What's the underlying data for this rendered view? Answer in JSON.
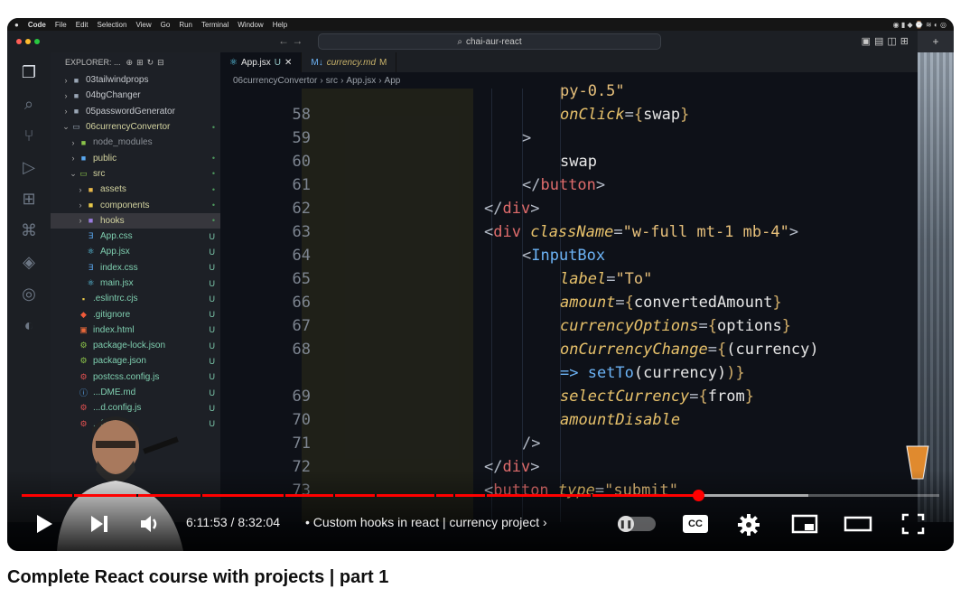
{
  "mac_menu": [
    "Code",
    "File",
    "Edit",
    "Selection",
    "View",
    "Go",
    "Run",
    "Terminal",
    "Window",
    "Help"
  ],
  "editor_window": {
    "search_text": "chai-aur-react",
    "explorer_header": "EXPLORER: ...",
    "tabs": [
      {
        "label": "App.jsx",
        "status": "U",
        "active": true
      },
      {
        "label": "currency.md",
        "status": "M",
        "active": false
      }
    ],
    "breadcrumb": [
      "06currencyConvertor",
      "src",
      "App.jsx",
      "App"
    ],
    "tree": [
      {
        "label": "03tailwindprops",
        "kind": "folder",
        "indent": 1,
        "badge": ""
      },
      {
        "label": "04bgChanger",
        "kind": "folder",
        "indent": 1,
        "badge": ""
      },
      {
        "label": "05passwordGenerator",
        "kind": "folder",
        "indent": 1,
        "badge": ""
      },
      {
        "label": "06currencyConvertor",
        "kind": "folder-open",
        "indent": 1,
        "badge": "•"
      },
      {
        "label": "node_modules",
        "kind": "folder",
        "indent": 2,
        "badge": ""
      },
      {
        "label": "public",
        "kind": "folder",
        "indent": 2,
        "badge": "•"
      },
      {
        "label": "src",
        "kind": "folder-open",
        "indent": 2,
        "badge": "•"
      },
      {
        "label": "assets",
        "kind": "folder",
        "indent": 3,
        "badge": "•"
      },
      {
        "label": "components",
        "kind": "folder",
        "indent": 3,
        "badge": "•"
      },
      {
        "label": "hooks",
        "kind": "folder",
        "indent": 3,
        "badge": "•"
      },
      {
        "label": "App.css",
        "kind": "css",
        "indent": 3,
        "badge": "U"
      },
      {
        "label": "App.jsx",
        "kind": "react",
        "indent": 3,
        "badge": "U"
      },
      {
        "label": "index.css",
        "kind": "css",
        "indent": 3,
        "badge": "U"
      },
      {
        "label": "main.jsx",
        "kind": "react",
        "indent": 3,
        "badge": "U"
      },
      {
        "label": ".eslintrc.cjs",
        "kind": "js",
        "indent": 2,
        "badge": "U"
      },
      {
        "label": ".gitignore",
        "kind": "git",
        "indent": 2,
        "badge": "U"
      },
      {
        "label": "index.html",
        "kind": "html",
        "indent": 2,
        "badge": "U"
      },
      {
        "label": "package-lock.json",
        "kind": "json",
        "indent": 2,
        "badge": "U"
      },
      {
        "label": "package.json",
        "kind": "json",
        "indent": 2,
        "badge": "U"
      },
      {
        "label": "postcss.config.js",
        "kind": "config",
        "indent": 2,
        "badge": "U"
      },
      {
        "label": "...DME.md",
        "kind": "md",
        "indent": 2,
        "badge": "U"
      },
      {
        "label": "...d.config.js",
        "kind": "config",
        "indent": 2,
        "badge": "U"
      },
      {
        "label": "...fig.js",
        "kind": "config",
        "indent": 2,
        "badge": "U"
      }
    ],
    "code_lines": [
      {
        "num": "",
        "indent": 2,
        "parts": [
          [
            "str",
            "py-0.5\""
          ]
        ]
      },
      {
        "num": "58",
        "indent": 2,
        "parts": [
          [
            "attr",
            "onClick"
          ],
          [
            "punct",
            "="
          ],
          [
            "br",
            "{"
          ],
          [
            "id",
            "swap"
          ],
          [
            "br",
            "}"
          ]
        ]
      },
      {
        "num": "59",
        "indent": 1,
        "parts": [
          [
            "punct",
            ">"
          ]
        ]
      },
      {
        "num": "60",
        "indent": 2,
        "parts": [
          [
            "id",
            "swap"
          ]
        ]
      },
      {
        "num": "61",
        "indent": 1,
        "parts": [
          [
            "punct",
            "</"
          ],
          [
            "tag",
            "button"
          ],
          [
            "punct",
            ">"
          ]
        ]
      },
      {
        "num": "62",
        "indent": 0,
        "parts": [
          [
            "punct",
            "</"
          ],
          [
            "tag",
            "div"
          ],
          [
            "punct",
            ">"
          ]
        ]
      },
      {
        "num": "63",
        "indent": 0,
        "parts": [
          [
            "punct",
            "<"
          ],
          [
            "tag",
            "div"
          ],
          [
            "id",
            " "
          ],
          [
            "attr",
            "className"
          ],
          [
            "punct",
            "="
          ],
          [
            "str",
            "\"w-full mt-1 mb-4\""
          ],
          [
            "punct",
            ">"
          ]
        ]
      },
      {
        "num": "64",
        "indent": 1,
        "parts": [
          [
            "punct",
            "<"
          ],
          [
            "kw",
            "InputBox"
          ]
        ]
      },
      {
        "num": "65",
        "indent": 2,
        "parts": [
          [
            "attr",
            "label"
          ],
          [
            "punct",
            "="
          ],
          [
            "str",
            "\"To\""
          ]
        ]
      },
      {
        "num": "66",
        "indent": 2,
        "parts": [
          [
            "attr",
            "amount"
          ],
          [
            "punct",
            "="
          ],
          [
            "br",
            "{"
          ],
          [
            "id",
            "convertedAmount"
          ],
          [
            "br",
            "}"
          ]
        ]
      },
      {
        "num": "67",
        "indent": 2,
        "parts": [
          [
            "attr",
            "currencyOptions"
          ],
          [
            "punct",
            "="
          ],
          [
            "br",
            "{"
          ],
          [
            "id",
            "options"
          ],
          [
            "br",
            "}"
          ]
        ]
      },
      {
        "num": "68",
        "indent": 2,
        "parts": [
          [
            "attr",
            "onCurrencyChange"
          ],
          [
            "punct",
            "="
          ],
          [
            "br",
            "{"
          ],
          [
            "id",
            "("
          ],
          [
            "id",
            "currency"
          ],
          [
            "id",
            ")"
          ]
        ]
      },
      {
        "num": "",
        "indent": 2,
        "parts": [
          [
            "kw",
            "=> "
          ],
          [
            "fn",
            "setTo"
          ],
          [
            "id",
            "(currency)"
          ],
          [
            "br",
            ")"
          ],
          [
            "br",
            "}"
          ]
        ]
      },
      {
        "num": "69",
        "indent": 2,
        "parts": [
          [
            "attr",
            "selectCurrency"
          ],
          [
            "punct",
            "="
          ],
          [
            "br",
            "{"
          ],
          [
            "id",
            "from"
          ],
          [
            "br",
            "}"
          ]
        ]
      },
      {
        "num": "70",
        "indent": 2,
        "parts": [
          [
            "attr",
            "amountDisable"
          ]
        ]
      },
      {
        "num": "71",
        "indent": 1,
        "parts": [
          [
            "punct",
            "/>"
          ]
        ]
      },
      {
        "num": "72",
        "indent": 0,
        "parts": [
          [
            "punct",
            "</"
          ],
          [
            "tag",
            "div"
          ],
          [
            "punct",
            ">"
          ]
        ]
      },
      {
        "num": "73",
        "indent": 0,
        "parts": [
          [
            "punct",
            "<"
          ],
          [
            "tag",
            "button"
          ],
          [
            "id",
            " "
          ],
          [
            "attr",
            "type"
          ],
          [
            "punct",
            "="
          ],
          [
            "str",
            "\"submit\""
          ]
        ]
      }
    ]
  },
  "player": {
    "current_time": "6:11:53",
    "duration": "8:32:04",
    "time_display": "6:11:53 / 8:32:04",
    "chapter": "Custom hooks in react | currency project",
    "progress": 0.737,
    "buffered_to": 0.857,
    "chapter_marks": [
      0.055,
      0.125,
      0.195,
      0.285,
      0.34,
      0.385,
      0.45,
      0.47,
      0.505,
      0.62
    ]
  },
  "video_title": "Complete React course with projects | part 1"
}
